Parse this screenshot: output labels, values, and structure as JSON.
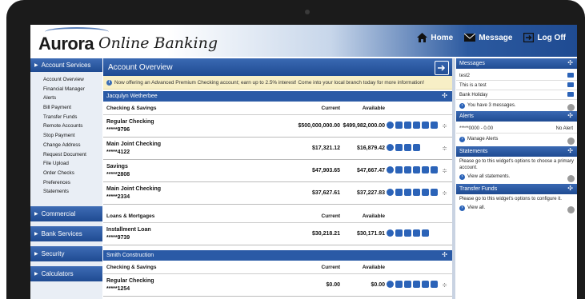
{
  "header": {
    "brand": "Aurora",
    "brand_sub": "Online Banking",
    "links": [
      {
        "label": "Home",
        "icon": "home-icon"
      },
      {
        "label": "Message",
        "icon": "envelope-icon"
      },
      {
        "label": "Log Off",
        "icon": "logout-icon"
      }
    ]
  },
  "sidebar": {
    "sections": [
      {
        "label": "Account Services",
        "expanded": true,
        "items": [
          "Account Overview",
          "Financial Manager",
          "Alerts",
          "Bill Payment",
          "Transfer Funds",
          "Remote Accounts",
          "Stop Payment",
          "Change Address",
          "Request Document",
          "File Upload",
          "Order Checks",
          "Preferences",
          "Statements"
        ]
      },
      {
        "label": "Commercial"
      },
      {
        "label": "Bank Services"
      },
      {
        "label": "Security"
      },
      {
        "label": "Calculators"
      }
    ]
  },
  "main": {
    "title": "Account Overview",
    "notice": "Now offering an Advanced Premium Checking account; earn up to 2.5% interest! Come into your local branch today for more information!",
    "customers": [
      {
        "name": "Jacqulyn Wetherbee",
        "groups": [
          {
            "title": "Checking & Savings",
            "current_label": "Current",
            "available_label": "Available",
            "accounts": [
              {
                "name": "Regular Checking",
                "number": "*****9796",
                "current": "$500,000,000.00",
                "available": "$499,982,000.00"
              },
              {
                "name": "Main Joint Checking",
                "number": "*****4122",
                "current": "$17,321.12",
                "available": "$16,879.42"
              },
              {
                "name": "Savings",
                "number": "*****2808",
                "current": "$47,903.65",
                "available": "$47,667.47"
              },
              {
                "name": "Main Joint Checking",
                "number": "*****2334",
                "current": "$37,627.61",
                "available": "$37,227.83"
              }
            ]
          },
          {
            "title": "Loans & Mortgages",
            "current_label": "Current",
            "available_label": "Available",
            "accounts": [
              {
                "name": "Installment Loan",
                "number": "*****9739",
                "current": "$30,218.21",
                "available": "$30,171.91"
              }
            ]
          }
        ]
      },
      {
        "name": "Smith Construction",
        "groups": [
          {
            "title": "Checking & Savings",
            "current_label": "Current",
            "available_label": "Available",
            "accounts": [
              {
                "name": "Regular Checking",
                "number": "*****1254",
                "current": "$0.00",
                "available": "$0.00"
              }
            ]
          }
        ]
      }
    ]
  },
  "right": {
    "messages": {
      "title": "Messages",
      "items": [
        "test2",
        "This is a test",
        "Bank Holiday"
      ],
      "footer": "You have 3 messages."
    },
    "alerts": {
      "title": "Alerts",
      "row_left": "*****0000 - 0.00",
      "row_right": "No Alert",
      "footer": "Manage Alerts"
    },
    "statements": {
      "title": "Statements",
      "text": "Please go to this widget's options to choose a primary account.",
      "footer": "View all statements."
    },
    "transfer": {
      "title": "Transfer Funds",
      "text": "Please go to this widget's options to configure it.",
      "footer": "View all."
    }
  }
}
